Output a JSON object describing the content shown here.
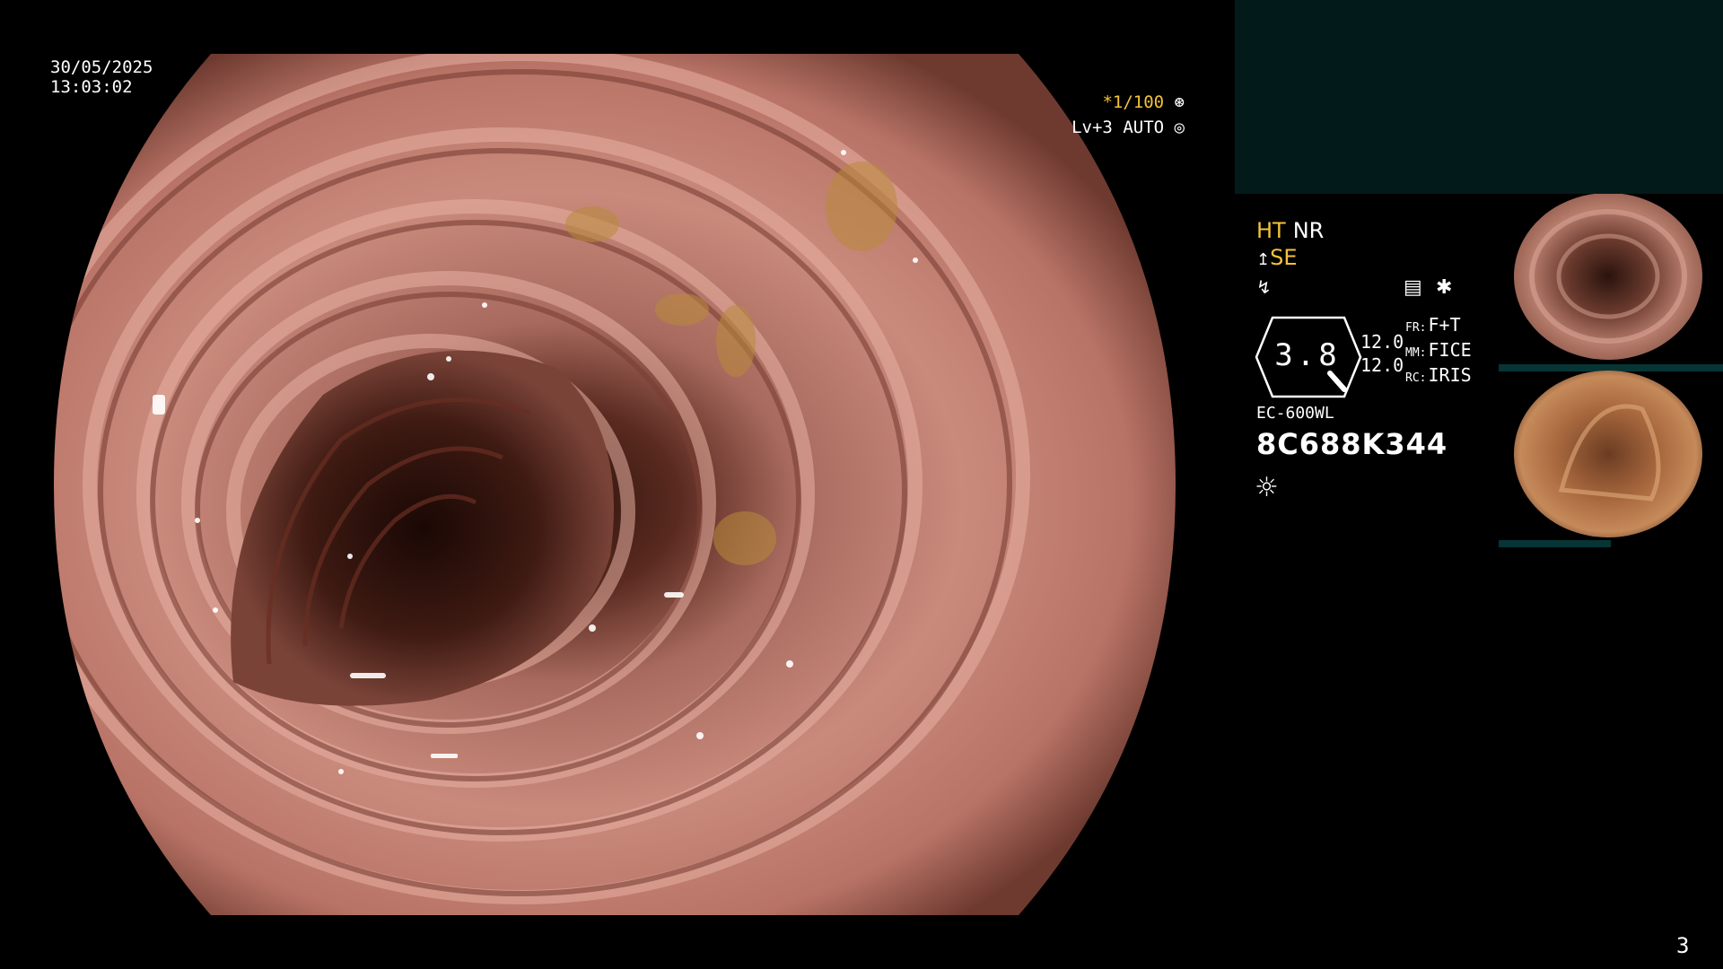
{
  "overlay": {
    "date": "30/05/2025",
    "time": "13:03:02",
    "shutter": "*1/100",
    "level": "Lv+3",
    "iris_mode": "AUTO"
  },
  "settings": {
    "ht": "HT",
    "nr": "NR",
    "se": "SE",
    "zoom": "3.8",
    "value1": "12.0",
    "value2": "12.0",
    "fr_label": "FR:",
    "fr_value": "F+T",
    "mm_label": "MM:",
    "mm_value": "FICE",
    "rc_label": "RC:",
    "rc_value": "IRIS"
  },
  "scope": {
    "model": "EC-600WL",
    "serial": "8C688K344"
  },
  "frame_number": "3",
  "icons": [
    "aperture-icon",
    "target-icon",
    "scope-tip-icon",
    "lightning-icon",
    "menu-icon",
    "asterisk-icon",
    "sun-icon"
  ],
  "colors": {
    "accent": "#f3c23a",
    "panel": "#031a1a",
    "tissue": "#c98a7a"
  }
}
